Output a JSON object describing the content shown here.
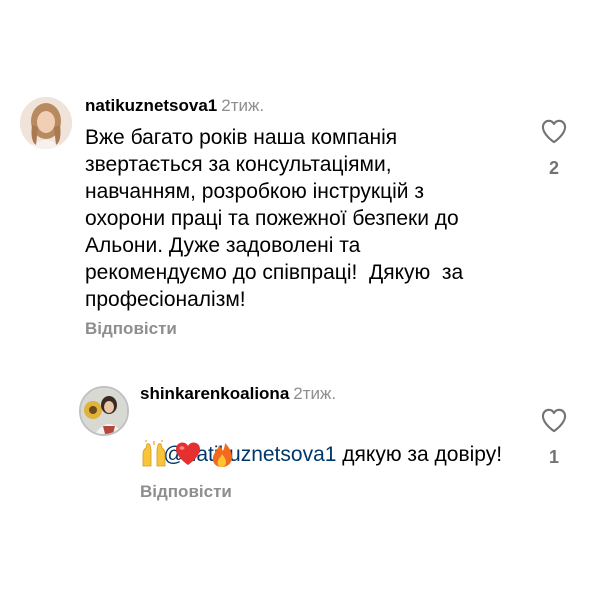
{
  "comments": [
    {
      "username": "natikuznetsova1",
      "time": "2тиж.",
      "text": "Вже багато років наша компанія\nзвертається за консультаціями,\nнавчанням, розробкою інструкцій з\nохорони праці та пожежної безпеки до\nАльони. Дуже задоволені та\nрекомендуємо до співпраці!  Дякую  за\nпрофесіоналізм!",
      "reply_label": "Відповісти",
      "like_count": "2",
      "like_icon": "heart-outline-icon"
    }
  ],
  "reply": {
    "username": "shinkarenkoaliona",
    "time": "2тиж.",
    "mention": "@natikuznetsova1",
    "text": " дякую за довіру!",
    "emojis": [
      "raising-hands-emoji",
      "red-heart-emoji",
      "fire-emoji"
    ],
    "reply_label": "Відповісти",
    "like_count": "1",
    "like_icon": "heart-outline-icon"
  },
  "colors": {
    "username": "#000000",
    "secondary": "#8e8e8e",
    "mention": "#00376b",
    "story_ring": "#c0c0c0"
  }
}
